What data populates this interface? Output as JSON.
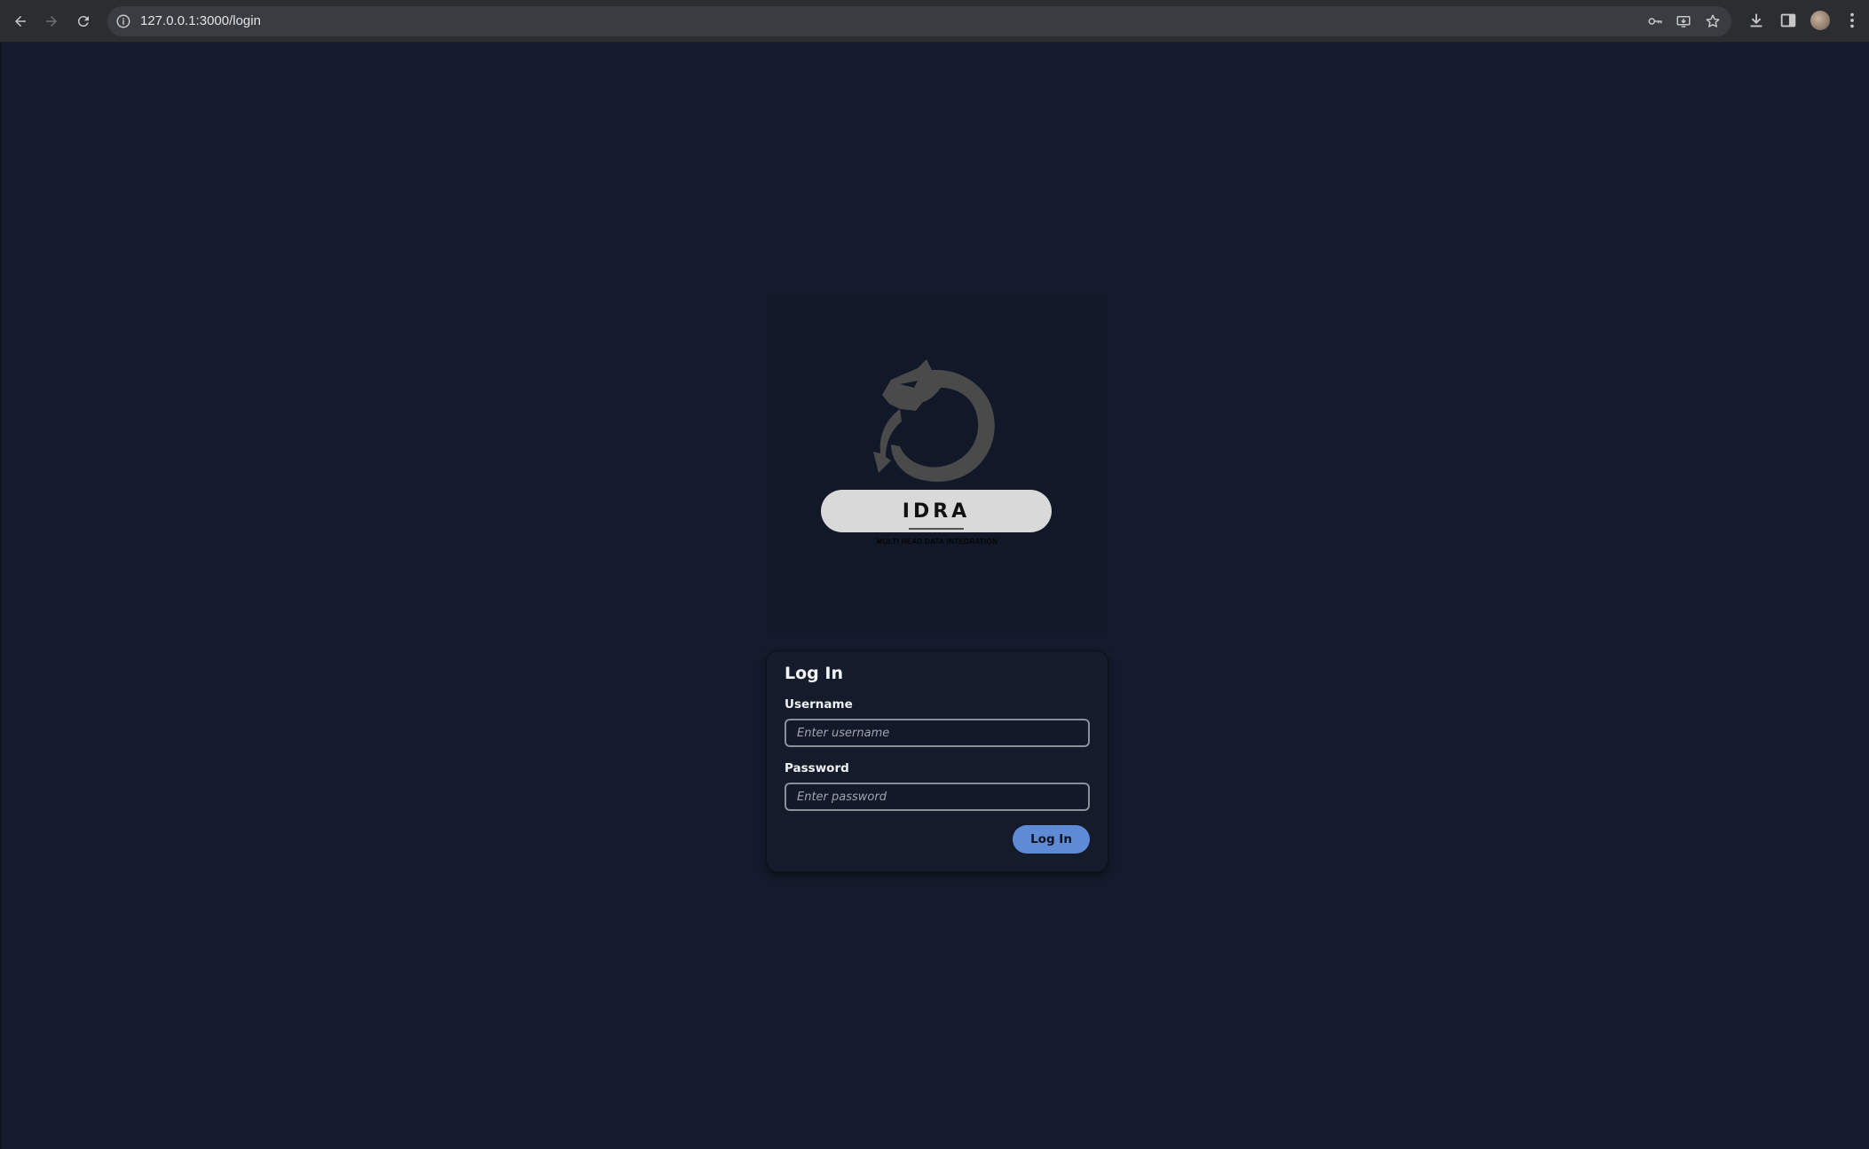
{
  "browser": {
    "url": "127.0.0.1:3000/login",
    "icons": {
      "back": "arrow-left-icon",
      "forward": "arrow-right-icon",
      "reload": "reload-icon",
      "site_info": "info-icon",
      "password_manager": "key-icon",
      "install_app": "install-app-icon",
      "bookmark": "star-icon",
      "downloads": "download-icon",
      "side_panel": "side-panel-icon",
      "profile": "avatar",
      "menu": "kebab-menu-icon"
    }
  },
  "logo": {
    "title": "IDRA",
    "tagline": "MULTI HEAD DATA INTEGRATION"
  },
  "login": {
    "heading": "Log In",
    "username_label": "Username",
    "username_placeholder": "Enter username",
    "username_value": "",
    "password_label": "Password",
    "password_placeholder": "Enter password",
    "password_value": "",
    "submit_label": "Log In"
  },
  "colors": {
    "page_background": "#141b2c",
    "card_background": "#141b2b",
    "logo_panel_background": "#111828",
    "accent_button": "#5f8ad6",
    "logo_mark": "#4a4a4a",
    "logo_pill": "#d9d9d9"
  }
}
